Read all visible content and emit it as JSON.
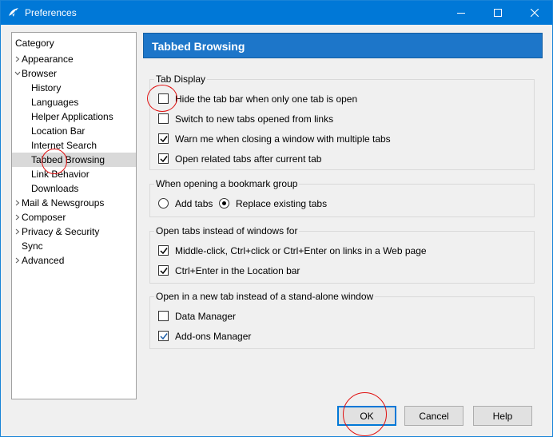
{
  "window": {
    "title": "Preferences",
    "controls": {
      "minimize": "minimize-icon",
      "maximize": "maximize-icon",
      "close": "close-icon"
    }
  },
  "sidebar": {
    "title": "Category",
    "items": [
      {
        "label": "Appearance",
        "level": 0,
        "expander": "collapsed"
      },
      {
        "label": "Browser",
        "level": 0,
        "expander": "expanded"
      },
      {
        "label": "History",
        "level": 1
      },
      {
        "label": "Languages",
        "level": 1
      },
      {
        "label": "Helper Applications",
        "level": 1
      },
      {
        "label": "Location Bar",
        "level": 1
      },
      {
        "label": "Internet Search",
        "level": 1
      },
      {
        "label": "Tabbed Browsing",
        "level": 1,
        "selected": true
      },
      {
        "label": "Link Behavior",
        "level": 1
      },
      {
        "label": "Downloads",
        "level": 1
      },
      {
        "label": "Mail & Newsgroups",
        "level": 0,
        "expander": "collapsed"
      },
      {
        "label": "Composer",
        "level": 0,
        "expander": "collapsed"
      },
      {
        "label": "Privacy & Security",
        "level": 0,
        "expander": "collapsed"
      },
      {
        "label": "Sync",
        "level": 0
      },
      {
        "label": "Advanced",
        "level": 0,
        "expander": "collapsed"
      }
    ]
  },
  "pane": {
    "title": "Tabbed Browsing",
    "tab_display": {
      "legend": "Tab Display",
      "options": [
        {
          "label": "Hide the tab bar when only one tab is open",
          "checked": false
        },
        {
          "label": "Switch to new tabs opened from links",
          "checked": false
        },
        {
          "label": "Warn me when closing a window with multiple tabs",
          "checked": true
        },
        {
          "label": "Open related tabs after current tab",
          "checked": true
        }
      ]
    },
    "bookmark_group": {
      "legend": "When opening a bookmark group",
      "options": [
        {
          "label": "Add tabs",
          "selected": false
        },
        {
          "label": "Replace existing tabs",
          "selected": true
        }
      ]
    },
    "open_tabs": {
      "legend": "Open tabs instead of windows for",
      "options": [
        {
          "label": "Middle-click, Ctrl+click or Ctrl+Enter on links in a Web page",
          "checked": true
        },
        {
          "label": "Ctrl+Enter in the Location bar",
          "checked": true
        }
      ]
    },
    "new_tab": {
      "legend": "Open in a new tab instead of a stand-alone window",
      "options": [
        {
          "label": "Data Manager",
          "checked": false
        },
        {
          "label": "Add-ons Manager",
          "checked": true
        }
      ]
    }
  },
  "buttons": {
    "ok": "OK",
    "cancel": "Cancel",
    "help": "Help"
  },
  "colors": {
    "titlebar": "#0078d7",
    "pane_header": "#1d76c9",
    "annotation": "#e01010"
  }
}
